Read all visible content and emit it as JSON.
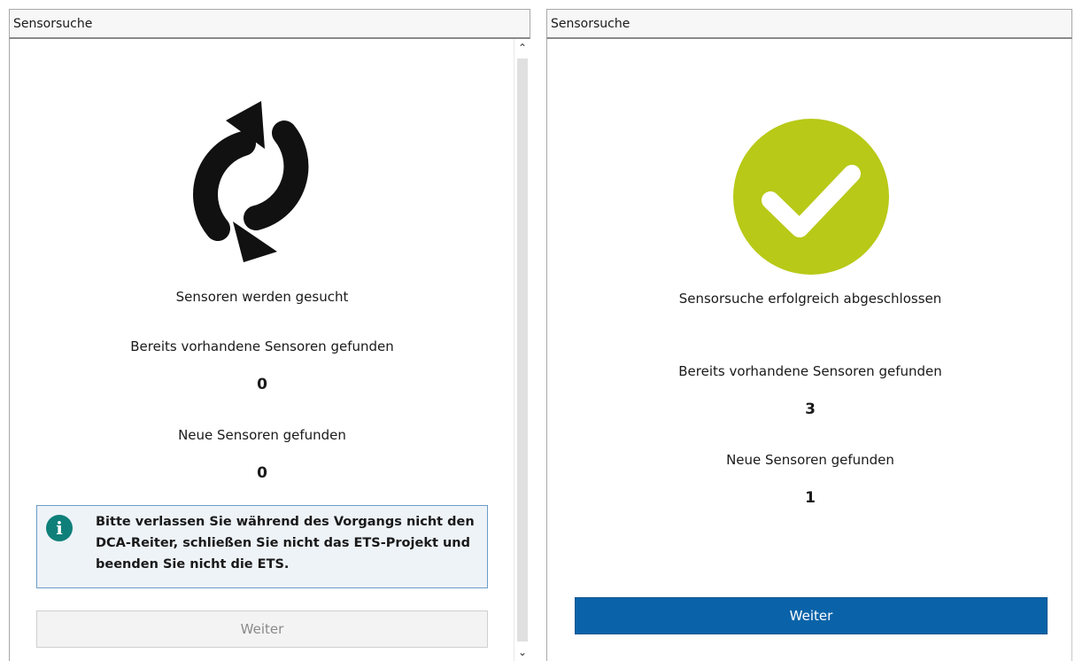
{
  "left_panel": {
    "title": "Sensorsuche",
    "status_text": "Sensoren werden gesucht",
    "existing_label": "Bereits vorhandene Sensoren gefunden",
    "existing_count": "0",
    "new_label": "Neue Sensoren gefunden",
    "new_count": "0",
    "info_message": "Bitte verlassen Sie während des Vorgangs nicht den DCA-Reiter, schließen Sie nicht das ETS-Projekt und beenden Sie nicht die ETS.",
    "next_button": "Weiter",
    "next_button_enabled": false,
    "icon": "refresh-icon"
  },
  "right_panel": {
    "title": "Sensorsuche",
    "status_text": "Sensorsuche erfolgreich abgeschlossen",
    "existing_label": "Bereits vorhandene Sensoren gefunden",
    "existing_count": "3",
    "new_label": "Neue Sensoren gefunden",
    "new_count": "1",
    "next_button": "Weiter",
    "next_button_enabled": true,
    "icon": "checkmark-icon"
  },
  "colors": {
    "success": "#b8c917",
    "primary_button": "#0a63a9",
    "info_icon": "#0f7f7a",
    "info_border": "#6b9cc8"
  }
}
